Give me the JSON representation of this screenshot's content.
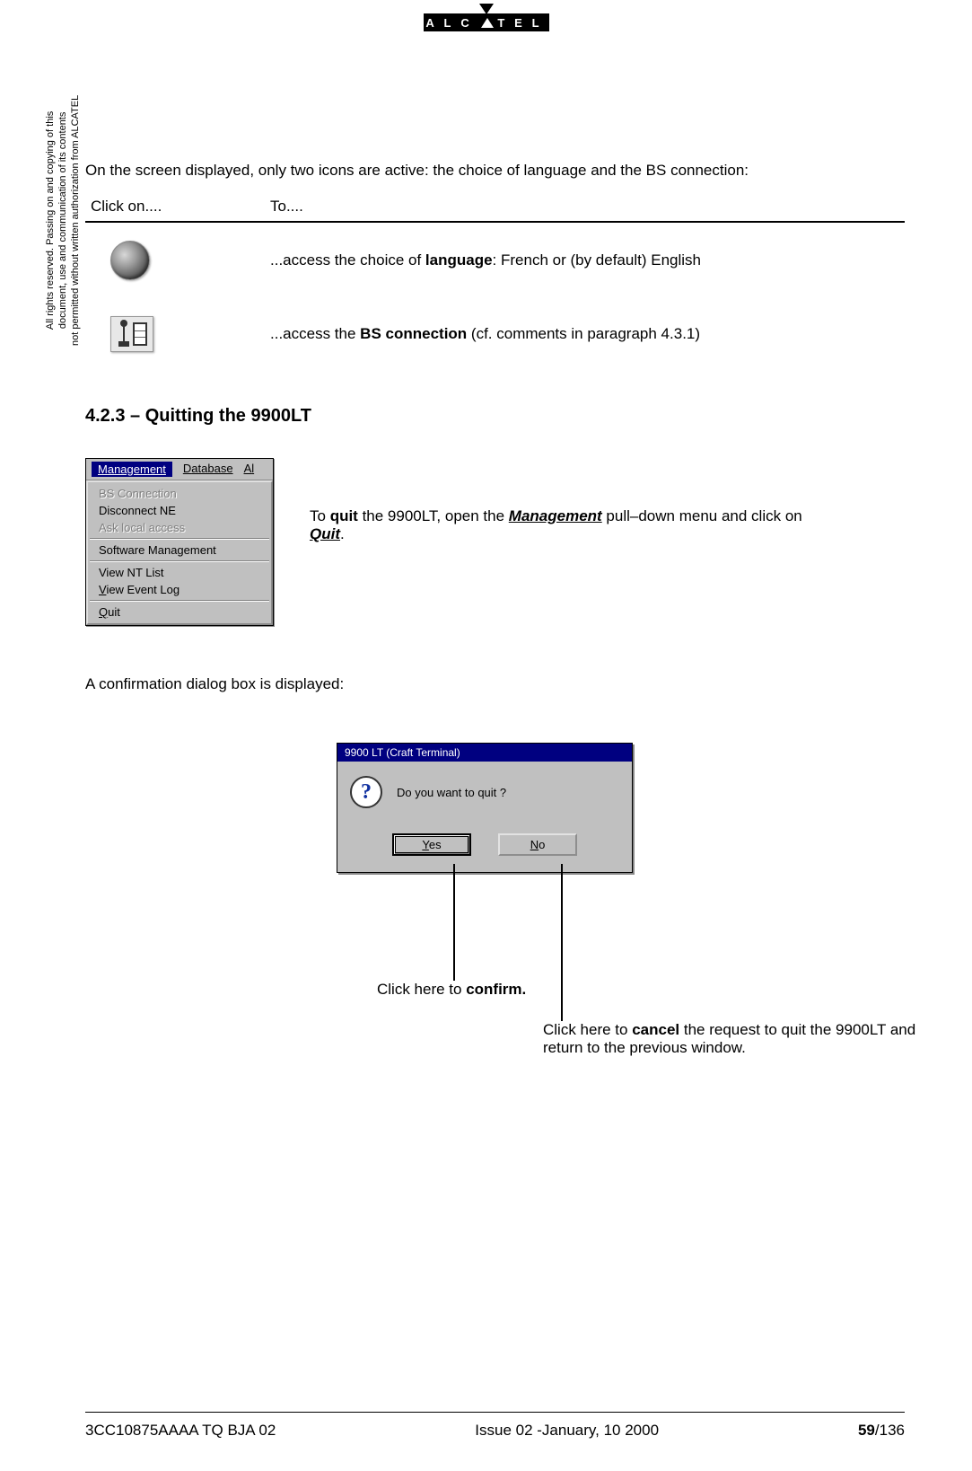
{
  "brand": "A L C ▲ T E L",
  "side_notice": "All rights reserved. Passing on and copying of this\ndocument, use and communication of its contents\nnot permitted without written authorization from ALCATEL",
  "intro": "On the screen displayed, only two icons are active: the choice of language and the BS connection:",
  "table": {
    "h1": "Click on....",
    "h2": "To....",
    "row1_pre": "...access the choice of ",
    "row1_b": "language",
    "row1_post": ": French or (by default) English",
    "row2_pre": "...access the ",
    "row2_b": "BS connection",
    "row2_post": "  (cf. comments in paragraph 4.3.1)"
  },
  "section_heading": "4.2.3 – Quitting the 9900LT",
  "menu": {
    "bar_management": "Management",
    "bar_database": "Database",
    "bar_al": "Al",
    "items": {
      "bs": "BS Connection",
      "disc": "Disconnect NE",
      "ask": "Ask local access",
      "soft": "Software Management",
      "nt": "View NT List",
      "ev": "View Event Log",
      "quit": "Quit"
    }
  },
  "menu_caption_pre": "To ",
  "menu_caption_b1": "quit",
  "menu_caption_mid1": " the 9900LT, open the ",
  "menu_caption_b2": "Management",
  "menu_caption_mid2": " pull–down menu and click on ",
  "menu_caption_b3": "Quit",
  "menu_caption_end": ".",
  "confirm_line": "A confirmation dialog box is displayed:",
  "dialog": {
    "title": "9900 LT (Craft Terminal)",
    "msg": "Do you want to quit ?",
    "yes": "Yes",
    "no": "No"
  },
  "callout_confirm_pre": "Click here to ",
  "callout_confirm_b": "confirm.",
  "callout_cancel_pre": "Click here to ",
  "callout_cancel_b": "cancel",
  "callout_cancel_post": " the request to quit the 9900LT and return to the previous window.",
  "footer": {
    "doc": "3CC10875AAAA TQ BJA 02",
    "issue": "Issue 02 -January, 10 2000",
    "page_cur": "59",
    "page_tot": "/136"
  }
}
